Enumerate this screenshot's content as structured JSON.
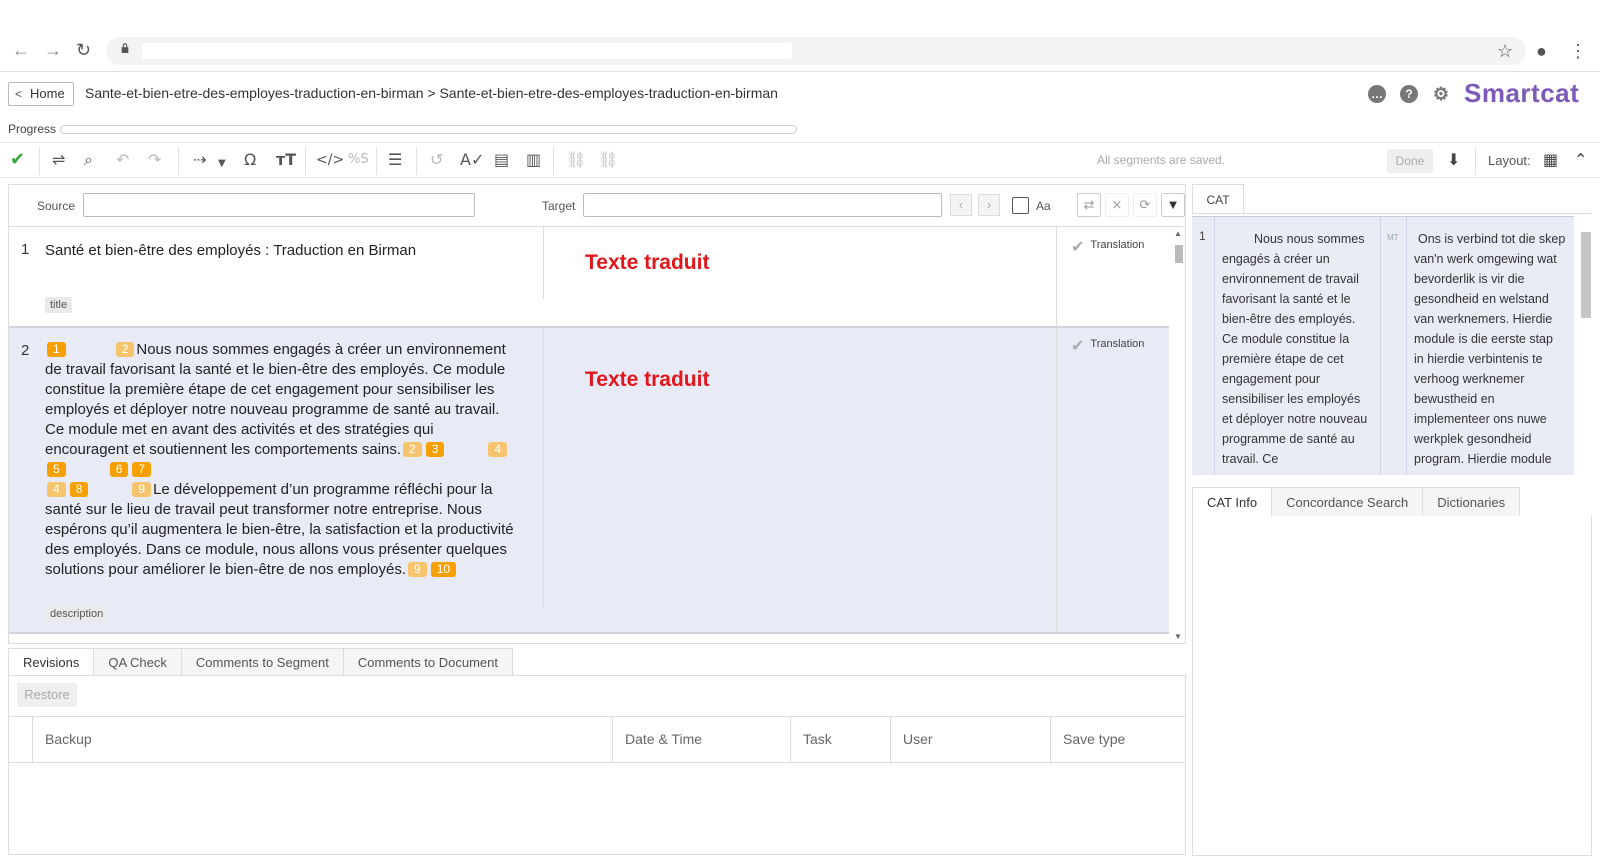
{
  "browser": {
    "back": "←",
    "forward": "→",
    "reload": "↻",
    "star": "☆",
    "account": "●",
    "menu": "⋮"
  },
  "header": {
    "home_label": "Home",
    "breadcrumb": "Sante-et-bien-etre-des-employes-traduction-en-birman > Sante-et-bien-etre-des-employes-traduction-en-birman",
    "progress_label": "Progress",
    "logo": "Smartcat",
    "brand_color": "#7d5ab8"
  },
  "toolbar": {
    "status_text": "All segments are saved.",
    "done_label": "Done",
    "layout_label": "Layout:"
  },
  "filter": {
    "source_label": "Source",
    "target_label": "Target",
    "case_label": "Aa"
  },
  "segments": [
    {
      "num": "1",
      "source": "Santé et bien-être des employés : Traduction en Birman",
      "target": "Texte traduit",
      "status": "Translation",
      "tag": "title"
    },
    {
      "num": "2",
      "source_parts": {
        "p1": "Nous nous sommes engagés à créer un environnement de travail favorisant la santé et le bien-être des employés. Ce module constitue la première étape de cet engagement pour sensibiliser les employés et déployer notre nouveau programme de santé au travail. Ce module met en avant des activités et des stratégies qui encouragent et soutiennent les comportements sains.",
        "p2": "Le développement d’un programme réfléchi pour la santé sur le lieu de travail peut transformer notre entreprise. Nous espérons qu’il augmentera le bien-être, la satisfaction et la productivité des employés. Dans ce module, nous allons vous présenter quelques solutions pour améliorer le bien-être de nos employés."
      },
      "placeholders": [
        "1",
        "2",
        "2",
        "3",
        "4",
        "5",
        "6",
        "7",
        "4",
        "8",
        "9",
        "9",
        "10"
      ],
      "target": "Texte traduit",
      "status": "Translation",
      "tag": "description"
    }
  ],
  "bottom_tabs": [
    "Revisions",
    "QA Check",
    "Comments to Segment",
    "Comments to Document"
  ],
  "revisions": {
    "restore_label": "Restore",
    "columns": [
      "Backup",
      "Date & Time",
      "Task",
      "User",
      "Save type"
    ]
  },
  "cat": {
    "tab_label": "CAT",
    "match_num": "1",
    "match_source": "Nous nous sommes engagés à créer un environnement de travail favorisant la santé et le bien-être des employés. Ce module constitue la première étape de cet engagement pour sensibiliser les employés et déployer notre nouveau programme de santé au travail. Ce",
    "match_type": "MT",
    "match_target": "Ons is verbind tot die skep van'n werk omgewing wat bevorderlik is vir die gesondheid en welstand van werknemers. Hierdie module is die eerste stap in hierdie verbintenis te verhoog werknemer bewustheid en implementeer ons nuwe werkplek gesondheid program. Hierdie module"
  },
  "info_tabs": [
    "CAT Info",
    "Concordance Search",
    "Dictionaries"
  ]
}
